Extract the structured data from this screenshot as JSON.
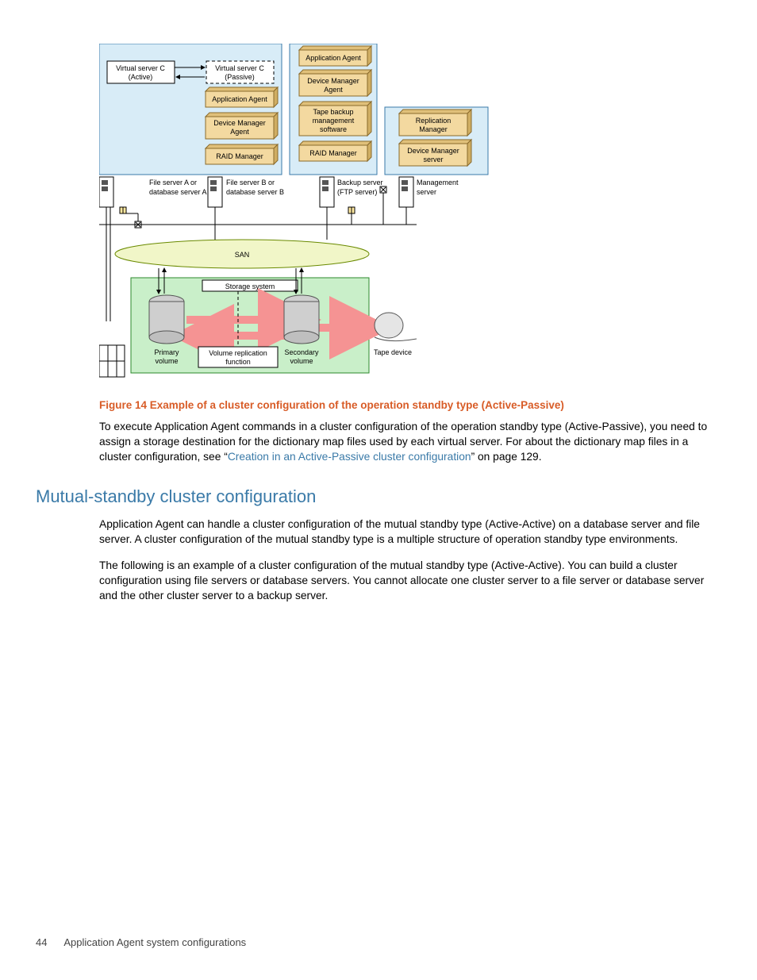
{
  "diagram": {
    "vserver_c_active_l1": "Virtual server C",
    "vserver_c_active_l2": "(Active)",
    "vserver_c_passive_l1": "Virtual server C",
    "vserver_c_passive_l2": "(Passive)",
    "app_agent": "Application Agent",
    "dev_mgr_agent_l1": "Device Manager",
    "dev_mgr_agent_l2": "Agent",
    "raid_mgr": "RAID Manager",
    "tape_sw_l1": "Tape backup",
    "tape_sw_l2": "management",
    "tape_sw_l3": "software",
    "repl_mgr_l1": "Replication",
    "repl_mgr_l2": "Manager",
    "dev_mgr_srv_l1": "Device Manager",
    "dev_mgr_srv_l2": "server",
    "file_a_l1": "File server A or",
    "file_a_l2": "database server A",
    "file_b_l1": "File server B or",
    "file_b_l2": "database server B",
    "backup_srv_l1": "Backup server",
    "backup_srv_l2": "(FTP server)",
    "mgmt_srv_l1": "Management",
    "mgmt_srv_l2": "server",
    "san": "SAN",
    "storage_system": "Storage system",
    "primary_vol_l1": "Primary",
    "primary_vol_l2": "volume",
    "secondary_vol_l1": "Secondary",
    "secondary_vol_l2": "volume",
    "vrf_l1": "Volume replication",
    "vrf_l2": "function",
    "tape_device": "Tape device"
  },
  "figure_caption": "Figure 14 Example of a cluster configuration of the operation standby type (Active-Passive)",
  "para1_a": "To execute Application Agent commands in a cluster configuration of the operation standby type (Active-Passive), you need to assign a storage destination for the dictionary map files used by each virtual server. For about the dictionary map files in a cluster configuration, see “",
  "para1_link": "Creation in an Active-Passive cluster configuration",
  "para1_b": "” on page 129.",
  "heading": "Mutual-standby cluster configuration",
  "para2": "Application Agent can handle a cluster configuration of the mutual standby type (Active-Active) on a database server and file server. A cluster configuration of the mutual standby type is a multiple structure of operation standby type environments.",
  "para3": "The following is an example of a cluster configuration of the mutual standby type (Active-Active). You can build a cluster configuration using file servers or database servers. You cannot allocate one cluster server to a file server or database server and the other cluster server to a backup server.",
  "footer_page": "44",
  "footer_title": "Application Agent system configurations"
}
